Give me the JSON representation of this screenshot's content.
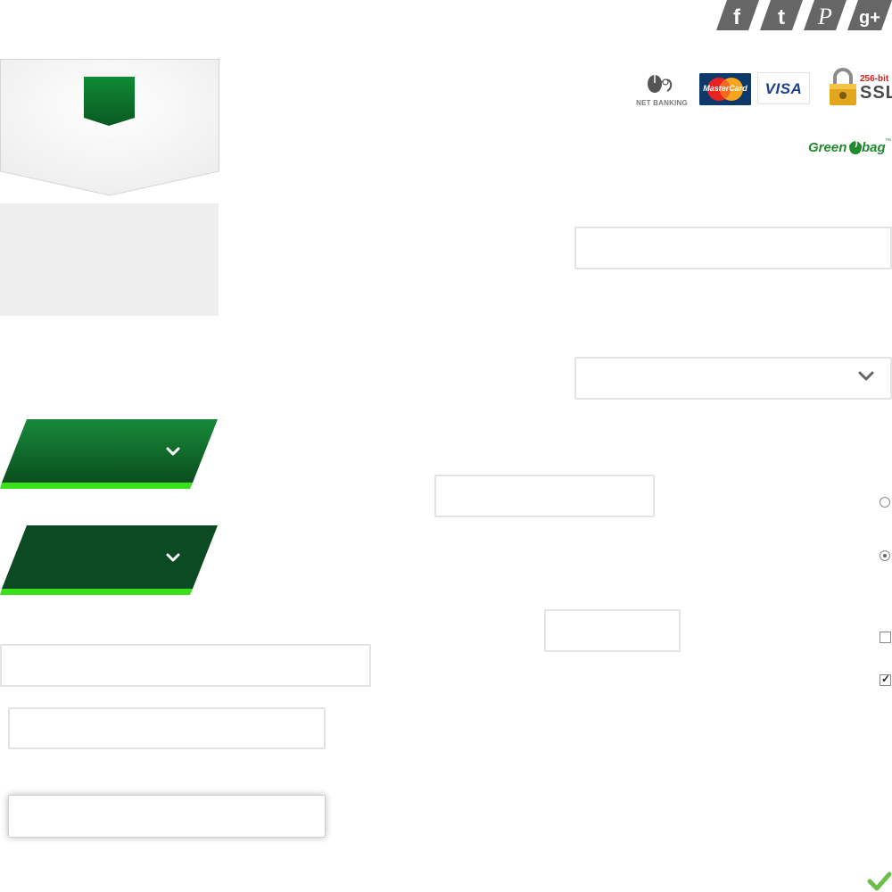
{
  "social": {
    "items": [
      {
        "icon": "facebook-icon",
        "glyph": "f"
      },
      {
        "icon": "twitter-icon",
        "glyph": "t"
      },
      {
        "icon": "pinterest-icon",
        "glyph": "P"
      },
      {
        "icon": "google-plus-icon",
        "glyph": "g+"
      }
    ],
    "color": "#666666"
  },
  "payment": {
    "netbanking_label": "NET BANKING",
    "mastercard_label": "MasterCard",
    "visa_label": "VISA",
    "ssl_bits": "256-bit",
    "ssl_label": "SSL"
  },
  "brand": {
    "name_part1": "Green",
    "name_part2": "bag",
    "mark": "™",
    "color": "#1f8a2e"
  },
  "colors": {
    "green_dark": "#0b5d24",
    "green_accent": "#39e11a",
    "panel_gray": "#eeeeee",
    "field_border": "#e3e3e3",
    "check_green": "#6cc04a"
  },
  "form": {
    "text_input_1": {
      "value": "",
      "placeholder": ""
    },
    "select_1": {
      "value": ""
    },
    "text_input_2": {
      "value": "",
      "placeholder": ""
    },
    "text_input_3": {
      "value": "",
      "placeholder": ""
    },
    "wide_input": {
      "value": "",
      "placeholder": ""
    },
    "input_a": {
      "value": "",
      "placeholder": ""
    },
    "input_b_focused": {
      "value": "",
      "placeholder": ""
    }
  },
  "controls": {
    "radio_1_checked": false,
    "radio_2_checked": true,
    "checkbox_1_checked": false,
    "checkbox_2_checked": true,
    "check_mark": "✓"
  }
}
